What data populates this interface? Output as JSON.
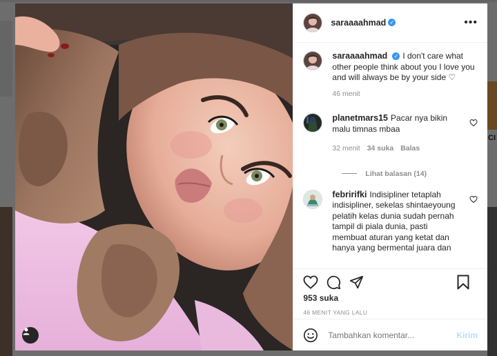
{
  "post": {
    "username": "saraaaahmad",
    "verified": true,
    "caption": "I don't care what other people think about you I love you and will always be by your side ♡",
    "caption_time": "46 menit"
  },
  "comments": [
    {
      "username": "planetmars15",
      "text": "Pacar nya bikin malu timnas mbaa",
      "time": "32 menit",
      "likes": "34 suka",
      "reply": "Balas",
      "view_replies": "Lihat balasan (14)"
    },
    {
      "username": "febririfki",
      "text": "Indisipliner tetaplah indisipliner, sekelas shintaeyoung pelatih kelas dunia sudah pernah tampil di piala dunia, pasti membuat aturan yang ketat dan hanya yang bermental juara dan"
    }
  ],
  "actions": {
    "likes": "953 suka",
    "posted": "46 MENIT YANG LALU"
  },
  "add_comment": {
    "placeholder": "Tambahkan komentar...",
    "post_label": "Kirim"
  },
  "background": {
    "side_label": "CI"
  },
  "icons": [
    "more-icon",
    "verified-icon",
    "heart-icon",
    "comment-icon",
    "share-icon",
    "bookmark-icon",
    "emoji-icon",
    "user-tag-icon"
  ]
}
